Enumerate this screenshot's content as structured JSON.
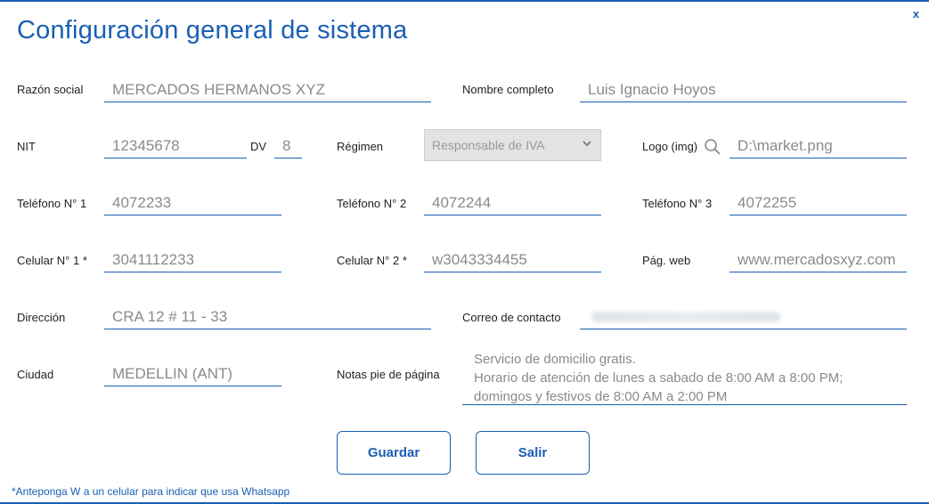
{
  "dialog": {
    "title": "Configuración general de sistema",
    "close_label": "x",
    "footnote": "*Anteponga W a un celular para indicar que usa Whatsapp"
  },
  "fields": {
    "razon_social": {
      "label": "Razón social",
      "value": "MERCADOS HERMANOS XYZ"
    },
    "nombre_completo": {
      "label": "Nombre completo",
      "value": "Luis Ignacio Hoyos"
    },
    "nit": {
      "label": "NIT",
      "value": "12345678"
    },
    "dv": {
      "label": "DV",
      "value": "8"
    },
    "regimen": {
      "label": "Régimen",
      "value": "Responsable de IVA"
    },
    "logo": {
      "label": "Logo (img)",
      "value": "D:\\market.png"
    },
    "telefono1": {
      "label": "Teléfono N° 1",
      "value": "4072233"
    },
    "telefono2": {
      "label": "Teléfono N° 2",
      "value": "4072244"
    },
    "telefono3": {
      "label": "Teléfono N° 3",
      "value": "4072255"
    },
    "celular1": {
      "label": "Celular N° 1 *",
      "value": "3041112233"
    },
    "celular2": {
      "label": "Celular N° 2 *",
      "value": "w3043334455"
    },
    "pag_web": {
      "label": "Pág. web",
      "value": "www.mercadosxyz.com"
    },
    "direccion": {
      "label": "Dirección",
      "value": "CRA 12 # 11 - 33"
    },
    "correo": {
      "label": "Correo de contacto",
      "value": ""
    },
    "ciudad": {
      "label": "Ciudad",
      "value": "MEDELLIN (ANT)"
    },
    "notas": {
      "label": "Notas pie de página",
      "value": "Servicio de domicilio gratis.\nHorario de atención de lunes a sabado de 8:00 AM a 8:00 PM;\ndomingos y festivos de 8:00 AM a 2:00 PM"
    }
  },
  "buttons": {
    "save": "Guardar",
    "exit": "Salir"
  },
  "colors": {
    "accent": "#1a5fb4",
    "disabled_bg": "#e3e3e3"
  },
  "icons": {
    "logo_search": "search-icon",
    "regimen_dropdown": "chevron-down-icon"
  }
}
